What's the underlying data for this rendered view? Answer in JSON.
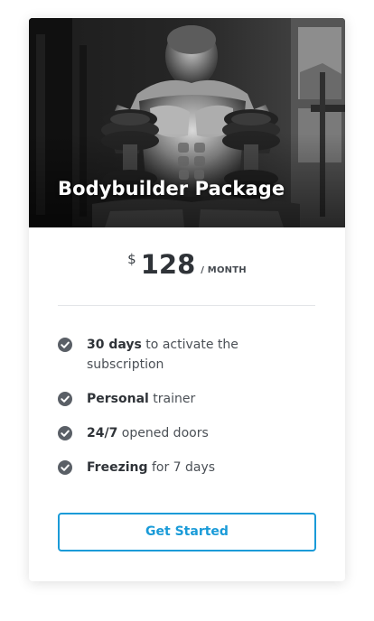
{
  "card": {
    "title": "Bodybuilder Package",
    "hero_image": "bodybuilder-with-dumbbells-photo"
  },
  "price": {
    "currency": "$",
    "amount": "128",
    "period": "/ MONTH"
  },
  "features": [
    {
      "strong": "30 days",
      "text": " to activate the subscription",
      "icon": "check-circle-icon"
    },
    {
      "strong": "Personal",
      "text": " trainer",
      "icon": "check-circle-icon"
    },
    {
      "strong": "24/7",
      "text": " opened doors",
      "icon": "check-circle-icon"
    },
    {
      "strong": "Freezing",
      "text": " for 7 days",
      "icon": "check-circle-icon"
    }
  ],
  "cta": {
    "label": "Get Started"
  },
  "colors": {
    "accent": "#1a9bd8",
    "text": "#2f3338",
    "icon": "#5a5f66"
  }
}
